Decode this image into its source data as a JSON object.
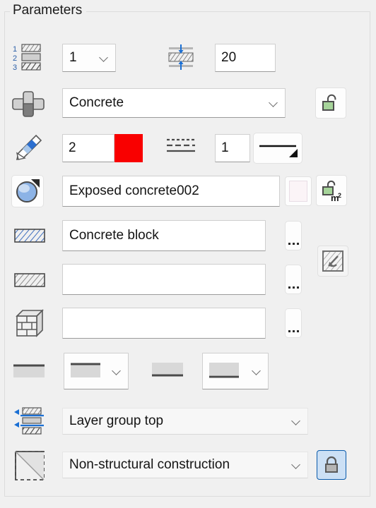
{
  "panel": {
    "title": "Parameters",
    "background_color": "#f0f0f0",
    "border_color": "#dcdcdc"
  },
  "rows": [
    {
      "id": "layer-count",
      "icon": "layer-numbering-icon",
      "combo_value": "1",
      "secondary_icon": "layer-thickness-icon",
      "thickness_value": "20"
    },
    {
      "id": "building-material",
      "icon": "building-material-icon",
      "combo_value": "Concrete",
      "lock_button": "unlock-material-icon",
      "lock_state": "unlocked"
    },
    {
      "id": "pen",
      "icon": "pen-icon",
      "pen_value": "2",
      "pen_color": "#f90000",
      "line_icon": "line-pattern-icon",
      "line_pen_value": "1",
      "line_style": "solid-line-dropdown"
    },
    {
      "id": "surface-material",
      "icon": "surface-material-icon",
      "value": "Exposed concrete002",
      "swatch_color": "#fbf4f7",
      "area_lock_button": "unlock-area-m2-icon"
    },
    {
      "id": "cut-fill",
      "icon": "hatch-blue-icon",
      "value": "Concrete block",
      "browse_label": "...",
      "side_button": "hatch-orientation-icon"
    },
    {
      "id": "cover-fill",
      "icon": "hatch-gray-icon",
      "value": "",
      "browse_label": "..."
    },
    {
      "id": "masonry-fill",
      "icon": "masonry-3d-icon",
      "value": "",
      "browse_label": "..."
    },
    {
      "id": "edge-lines",
      "icon": "edge-line-icon",
      "left_combo": "line-top-preview",
      "middle_preview": "line-bottom-preview",
      "right_combo": "line-bottom-preview"
    },
    {
      "id": "layer-group",
      "icon": "layer-group-icon",
      "value": "Layer group top"
    },
    {
      "id": "structural-function",
      "icon": "structural-function-icon",
      "value": "Non-structural construction",
      "lock_button": "lock-closed-icon",
      "lock_state": "locked",
      "lock_highlight": "#cce0f5",
      "lock_border": "#0a5bab"
    }
  ]
}
